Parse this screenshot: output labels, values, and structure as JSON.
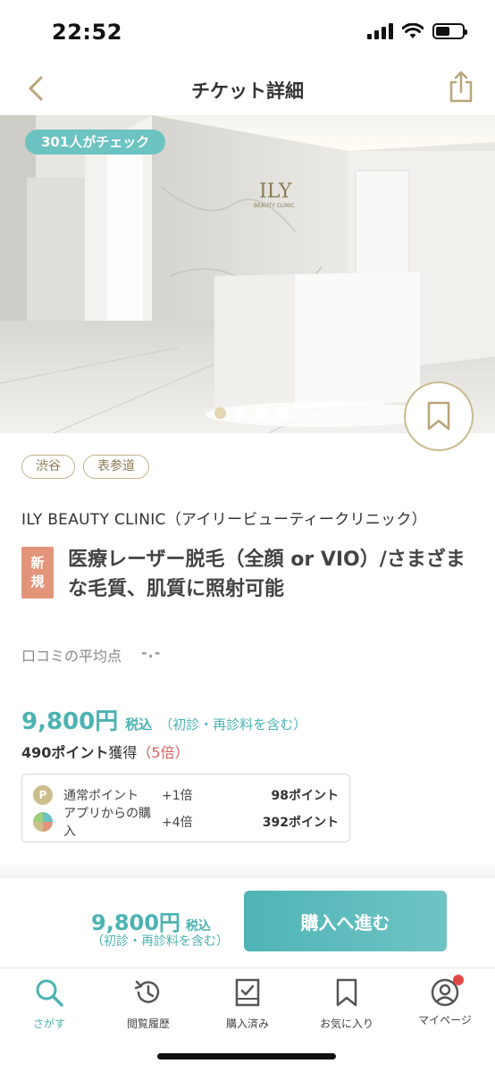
{
  "status_bar": {
    "time": "22:52"
  },
  "nav": {
    "title": "チケット詳細"
  },
  "hero": {
    "check_badge": "301人がチェック",
    "slide_count": 4,
    "active_slide": 1,
    "sign_text": "ILY",
    "sign_sub": "BEAUTY CLINIC"
  },
  "tags": [
    "渋谷",
    "表参道"
  ],
  "clinic": {
    "name": "ILY BEAUTY CLINIC（アイリービューティークリニック）"
  },
  "ticket": {
    "new_badge_line1": "新",
    "new_badge_line2": "規",
    "title": "医療レーザー脱毛（全顔 or VIO）/さまざまな毛質、肌質に照射可能"
  },
  "review": {
    "label": "口コミの平均点",
    "value": "-.-"
  },
  "price": {
    "amount": "9,800円",
    "tax": "税込",
    "note": "（初診・再診料を含む）"
  },
  "points": {
    "earn_amount": "490ポイント",
    "earn_suffix": "獲得",
    "multiplier": "（5倍）",
    "breakdown": [
      {
        "icon": "point-coin-icon",
        "label": "通常ポイント",
        "mult": "+1倍",
        "amount": "98ポイント"
      },
      {
        "icon": "app-purchase-icon",
        "label": "アプリからの購入",
        "mult": "+4倍",
        "amount": "392ポイント"
      }
    ]
  },
  "purchase_bar": {
    "amount": "9,800円",
    "tax": "税込",
    "note": "（初診・再診料を含む）",
    "button_label": "購入へ進む"
  },
  "tab_bar": {
    "items": [
      {
        "label": "さがす",
        "icon": "search-icon",
        "active": true
      },
      {
        "label": "閲覧履歴",
        "icon": "history-icon",
        "active": false
      },
      {
        "label": "購入済み",
        "icon": "purchased-icon",
        "active": false
      },
      {
        "label": "お気に入り",
        "icon": "bookmark-icon",
        "active": false
      },
      {
        "label": "マイページ",
        "icon": "profile-icon",
        "active": false
      }
    ]
  },
  "colors": {
    "accent": "#4bb3b2",
    "gold": "#c2b28a",
    "new_badge": "#e2957b",
    "alert": "#d96060"
  }
}
